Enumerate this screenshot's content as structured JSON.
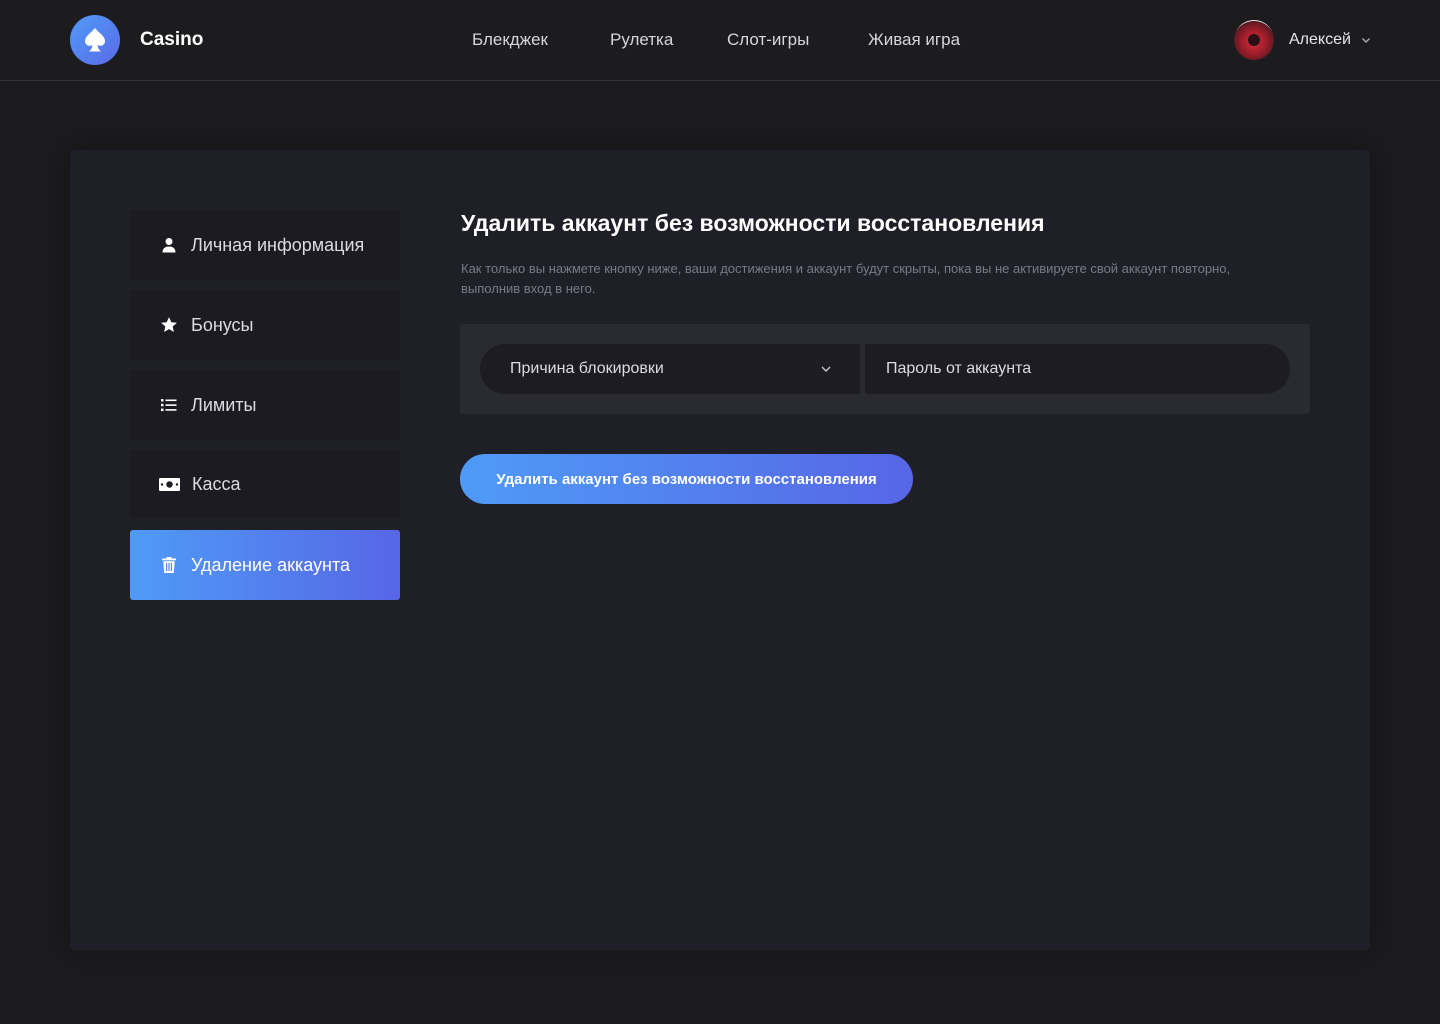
{
  "header": {
    "logo_text": "Casino",
    "nav": [
      "Блекджек",
      "Рулетка",
      "Слот-игры",
      "Живая игра"
    ],
    "user_name": "Алексей"
  },
  "sidebar": {
    "items": [
      {
        "label": "Личная информация",
        "icon": "user-icon"
      },
      {
        "label": "Бонусы",
        "icon": "star-icon"
      },
      {
        "label": "Лимиты",
        "icon": "list-icon"
      },
      {
        "label": "Касса",
        "icon": "cash-icon"
      },
      {
        "label": "Удаление аккаунта",
        "icon": "trash-icon",
        "active": true
      }
    ]
  },
  "main": {
    "title": "Удалить аккаунт без возможности восстановления",
    "description": "Как только вы нажмете кнопку ниже, ваши достижения и аккаунт будут скрыты, пока вы не активируете свой аккаунт повторно, выполнив вход в него.",
    "reason_select": "Причина блокировки",
    "password_placeholder": "Пароль от аккаунта",
    "delete_button": "Удалить аккаунт без возможности восстановления"
  },
  "colors": {
    "accent_start": "#4f9bf7",
    "accent_end": "#5766e6",
    "background": "#1c1c1f",
    "card": "#1f1f27"
  }
}
